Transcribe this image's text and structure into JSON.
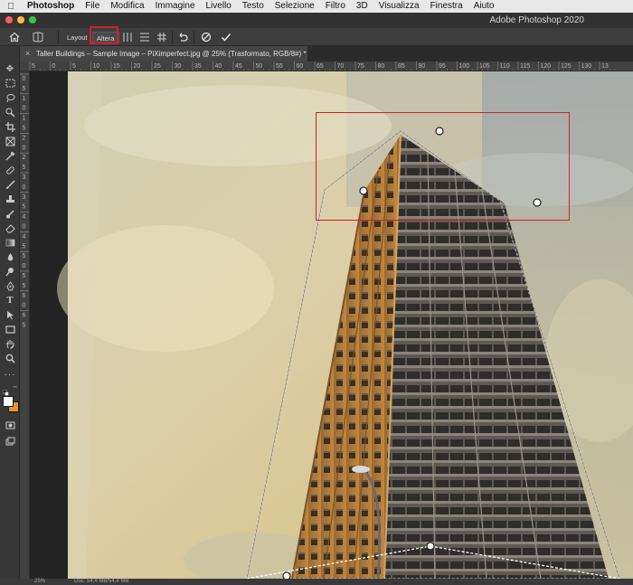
{
  "menubar": {
    "app": "Photoshop",
    "items": [
      "File",
      "Modifica",
      "Immagine",
      "Livello",
      "Testo",
      "Selezione",
      "Filtro",
      "3D",
      "Visualizza",
      "Finestra",
      "Aiuto"
    ]
  },
  "window": {
    "title": "Adobe Photoshop 2020"
  },
  "options": {
    "layout_label": "Layout",
    "altera_label": "Altera"
  },
  "document": {
    "tab_title": "Taller Buildings – Sample Image – PiXimperfect.jpg @ 25% (Trasformato, RGB/8#) *"
  },
  "ruler_top": [
    "5",
    "0",
    "5",
    "10",
    "15",
    "20",
    "25",
    "30",
    "35",
    "40",
    "45",
    "50",
    "55",
    "60",
    "65",
    "70",
    "75",
    "80",
    "85",
    "90",
    "95",
    "100",
    "105",
    "110",
    "115",
    "120",
    "125",
    "130",
    "13"
  ],
  "ruler_left": [
    "0",
    "5",
    "1",
    "0",
    "1",
    "5",
    "2",
    "0",
    "2",
    "5",
    "3",
    "0",
    "3",
    "5",
    "4",
    "0",
    "4",
    "5",
    "5",
    "0",
    "5",
    "5",
    "6",
    "0",
    "6",
    "5"
  ],
  "status": {
    "zoom": "25%",
    "doc": "Doc: 54,4 MB/54,4 MB"
  },
  "colors": {
    "annotation": "#d0202a",
    "foreground": "#ffffff",
    "background": "#e8922e"
  },
  "icons": [
    "home-icon",
    "warp-icon",
    "grid-split-v-icon",
    "grid-split-h-icon",
    "grid-icon",
    "undo-icon",
    "cancel-icon",
    "commit-check-icon"
  ]
}
